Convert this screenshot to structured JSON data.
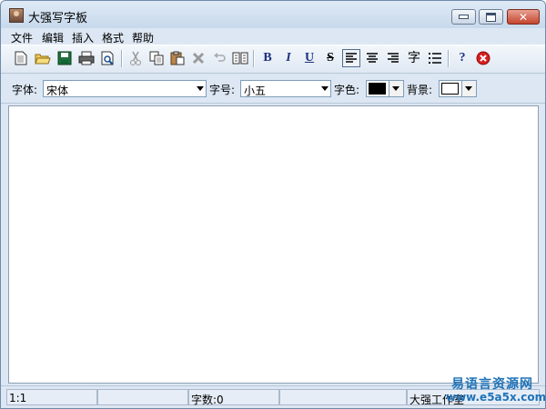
{
  "window": {
    "title": "大强写字板"
  },
  "menu": [
    "文件",
    "编辑",
    "插入",
    "格式",
    "帮助"
  ],
  "toolbar": {
    "icons": [
      "new-document-icon",
      "open-folder-icon",
      "save-icon",
      "print-icon",
      "print-preview-icon",
      "cut-icon",
      "copy-icon",
      "paste-icon",
      "delete-icon",
      "undo-icon",
      "view-pages-icon",
      "bold-icon",
      "italic-icon",
      "underline-icon",
      "strikethrough-icon",
      "align-left-icon",
      "align-center-icon",
      "align-right-icon",
      "char-format-icon",
      "bullet-list-icon",
      "help-icon",
      "close-icon"
    ],
    "glyphs": {
      "bold": "B",
      "italic": "I",
      "underline": "U",
      "strike": "S",
      "char": "字",
      "help": "?",
      "close": "✖"
    }
  },
  "format": {
    "font_label": "字体:",
    "font_value": "宋体",
    "size_label": "字号:",
    "size_value": "小五",
    "color_label": "字色:",
    "bg_label": "背景:",
    "text_color": "#000000",
    "bg_color": "#ffffff"
  },
  "status": {
    "position": "1:1",
    "word_count": "字数:0",
    "company": "大强工作室"
  },
  "watermark": {
    "line1": "易语言资源网",
    "line2": "www.e5a5x.com"
  },
  "colors": {
    "accent": "#1f73b8",
    "close_button": "#c4442d",
    "window_bg": "#dce7f3"
  }
}
